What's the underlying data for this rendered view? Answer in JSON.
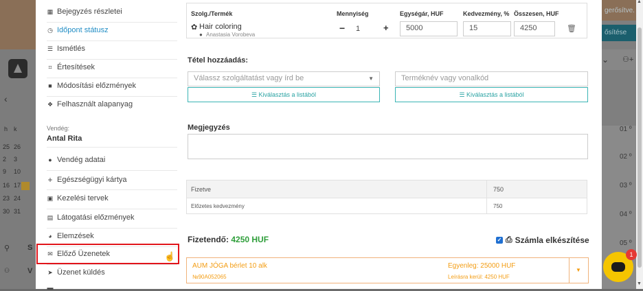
{
  "background": {
    "top_right_text_1": "gerősítve.",
    "top_right_button": "ősítése",
    "left_labels": [
      "S",
      "V"
    ],
    "calendar_weekdays": [
      "h",
      "k"
    ],
    "calendar_rows": [
      [
        "25",
        "26"
      ],
      [
        "2",
        "3"
      ],
      [
        "9",
        "10"
      ],
      [
        "16",
        "17"
      ],
      [
        "23",
        "24"
      ],
      [
        "30",
        "31"
      ]
    ],
    "right_times": [
      "01 º",
      "02 º",
      "03 º",
      "04 º",
      "05 º"
    ]
  },
  "sidebar": {
    "items_top": [
      {
        "label": "Bejegyzés részletei",
        "icon": "calendar-icon"
      },
      {
        "label": "Időpont státusz",
        "icon": "clock-icon"
      },
      {
        "label": "Ismétlés",
        "icon": "list-icon"
      },
      {
        "label": "Értesítések",
        "icon": "chat-icon"
      },
      {
        "label": "Módosítási előzmények",
        "icon": "file-icon"
      },
      {
        "label": "Felhasznált alapanyag",
        "icon": "cubes-icon"
      }
    ],
    "guest_label": "Vendég:",
    "guest_name": "Antal Rita",
    "items_bottom": [
      {
        "label": "Vendég adatai",
        "icon": "user-icon"
      },
      {
        "label": "Egészségügyi kártya",
        "icon": "plus-icon"
      },
      {
        "label": "Kezelési tervek",
        "icon": "briefcase-icon"
      },
      {
        "label": "Látogatási előzmények",
        "icon": "table-icon"
      },
      {
        "label": "Elemzések",
        "icon": "pie-chart-icon"
      },
      {
        "label": "Előző Üzenetek",
        "icon": "envelope-icon"
      },
      {
        "label": "Üzenet küldés",
        "icon": "send-icon"
      }
    ]
  },
  "table": {
    "headers": [
      "Szolg./Termék",
      "Mennyiség",
      "Egységár, HUF",
      "Kedvezmény, %",
      "Összesen, HUF"
    ],
    "row": {
      "service": "Hair coloring",
      "staff": "Anastasia Vorobeva",
      "quantity": "1",
      "unit_price": "5000",
      "discount": "15",
      "total": "4250"
    }
  },
  "add_item": {
    "title": "Tétel hozzáadás:",
    "service_placeholder": "Válassz szolgáltatást vagy írd be",
    "product_placeholder": "Terméknév vagy vonalkód",
    "select_list_label": "Kiválasztás a listából"
  },
  "note": {
    "title": "Megjegyzés"
  },
  "summary": {
    "paid_label": "Fizetve",
    "paid_value": "750",
    "prior_discount_label": "Előzetes kedvezmény",
    "prior_discount_value": "750"
  },
  "payable": {
    "label": "Fizetendő:",
    "value": "4250 HUF"
  },
  "invoice": {
    "label": "Számla elkészítése",
    "checked": true
  },
  "payment_option": {
    "name": "AUM JÓGA bérlet 10 alk",
    "code": "№90A052065",
    "balance": "Egyenleg: 25000 HUF",
    "deduct": "Leírásra kerül: 4250 HUF"
  },
  "chat_badge": "1",
  "colors": {
    "accent_teal": "#39b4b4",
    "highlight_red": "#e1141a",
    "payable_green": "#2e9e3a",
    "orange": "#f39c12"
  }
}
